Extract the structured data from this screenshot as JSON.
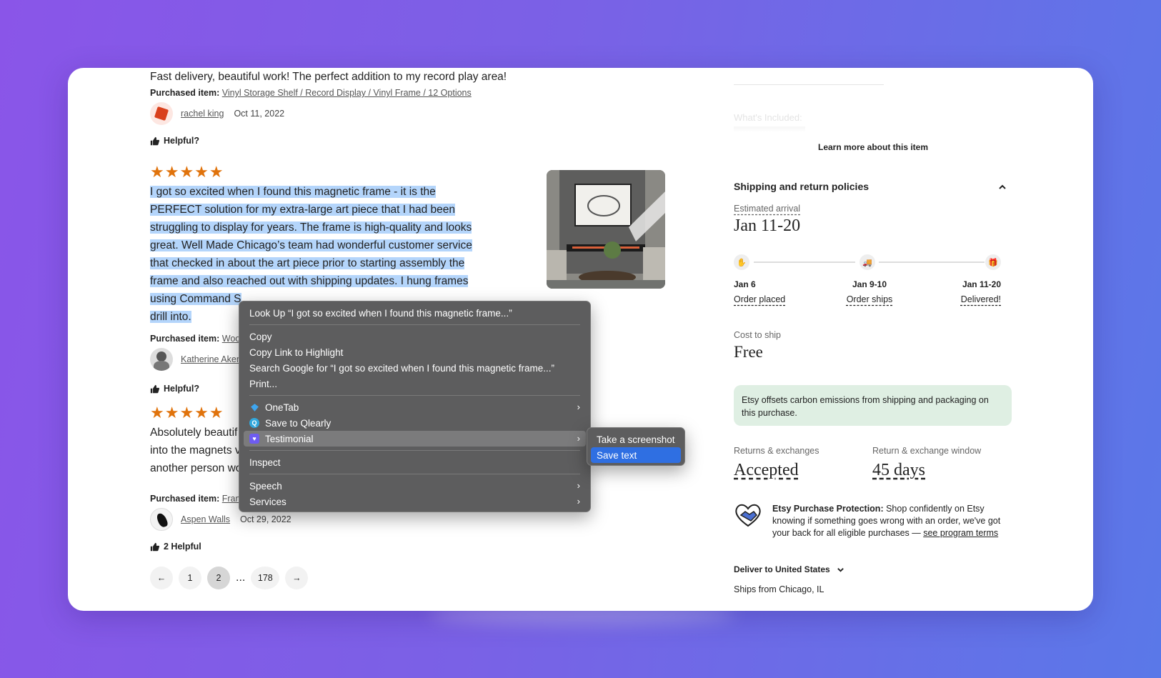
{
  "reviews": [
    {
      "text": "Fast delivery, beautiful work! The perfect addition to my record play area!",
      "purchased_label": "Purchased item:",
      "purchased_item": "Vinyl Storage Shelf / Record Display / Vinyl Frame / 12 Options",
      "reviewer": "rachel king",
      "date": "Oct 11, 2022",
      "helpful": "Helpful?"
    },
    {
      "stars": "★★★★★",
      "text_lines": [
        "I got so excited when I found this magnetic frame - it is the",
        "PERFECT solution for my extra-large art piece that I had been",
        "struggling to display for years. The frame is high-quality and looks",
        "great. Well Made Chicago’s team had wonderful customer service",
        "that checked in about the art piece prior to starting assembly the",
        "frame and also reached out with shipping updates. I hung frames",
        "using Command S",
        "drill into."
      ],
      "purchased_label": "Purchased item:",
      "purchased_item": "Woo",
      "reviewer": "Katherine Aker",
      "helpful": "Helpful?"
    },
    {
      "stars": "★★★★★",
      "text_lines": [
        "Absolutely beautif",
        "into the magnets v",
        "another person wo"
      ],
      "purchased_label": "Purchased item:",
      "purchased_item": "Fram",
      "reviewer": "Aspen Walls",
      "date": "Oct 29, 2022",
      "helpful": "2 Helpful"
    }
  ],
  "pagination": {
    "prev": "←",
    "pages": [
      "1",
      "2"
    ],
    "ellipsis": "...",
    "last": "178",
    "next": "→",
    "active": "2"
  },
  "right": {
    "whats_included": "What's Included:",
    "learn_more": "Learn more about this item",
    "shipping_title": "Shipping and return policies",
    "estimated_label": "Estimated arrival",
    "estimated_value": "Jan 11-20",
    "timeline": [
      {
        "date": "Jan 6",
        "label": "Order placed"
      },
      {
        "date": "Jan 9-10",
        "label": "Order ships"
      },
      {
        "date": "Jan 11-20",
        "label": "Delivered!"
      }
    ],
    "cost_label": "Cost to ship",
    "cost_value": "Free",
    "carbon": "Etsy offsets carbon emissions from shipping and packaging on this purchase.",
    "returns_label": "Returns & exchanges",
    "returns_value": "Accepted",
    "window_label": "Return & exchange window",
    "window_value": "45 days",
    "protection_title": "Etsy Purchase Protection:",
    "protection_text": "Shop confidently on Etsy knowing if something goes wrong with an order, we've got your back for all eligible purchases —",
    "protection_link": "see program terms",
    "deliver_to": "Deliver to United States",
    "ships_from": "Ships from Chicago, IL"
  },
  "context_menu": {
    "look_up": "Look Up “I got so excited when I found this magnetic frame...”",
    "copy": "Copy",
    "copy_link": "Copy Link to Highlight",
    "search_google": "Search Google for “I got so excited when I found this magnetic frame...”",
    "print": "Print...",
    "onetab": "OneTab",
    "qlearly": "Save to Qlearly",
    "testimonial": "Testimonial",
    "inspect": "Inspect",
    "speech": "Speech",
    "services": "Services",
    "chevron": "›"
  },
  "submenu": {
    "screenshot": "Take a screenshot",
    "save_text": "Save text"
  },
  "colors": {
    "star": "#e0730c",
    "selection": "#b4d5fb",
    "menu_bg": "#5d5d5e",
    "menu_highlight": "#2f6fe2",
    "carbon_bg": "#dfefe3"
  }
}
